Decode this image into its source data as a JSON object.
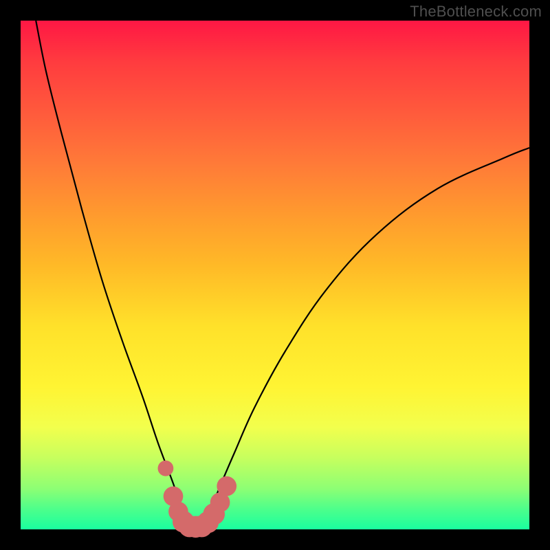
{
  "watermark": "TheBottleneck.com",
  "colors": {
    "background": "#000000",
    "curve_stroke": "#000000",
    "marker_fill": "#d46a6a",
    "watermark_text": "#4f4f4f"
  },
  "chart_data": {
    "type": "line",
    "title": "",
    "xlabel": "",
    "ylabel": "",
    "xlim": [
      0,
      100
    ],
    "ylim": [
      0,
      100
    ],
    "legend": false,
    "grid": false,
    "background_gradient": {
      "direction": "vertical",
      "stops": [
        {
          "pos": 0.0,
          "color": "#ff1744"
        },
        {
          "pos": 0.5,
          "color": "#ffb927"
        },
        {
          "pos": 0.72,
          "color": "#fff433"
        },
        {
          "pos": 1.0,
          "color": "#1aff9f"
        }
      ]
    },
    "series": [
      {
        "name": "bottleneck-curve",
        "x": [
          3,
          5,
          8,
          12,
          16,
          20,
          24,
          27,
          30,
          32,
          33.5,
          35,
          37,
          39,
          42,
          46,
          52,
          60,
          70,
          82,
          95,
          100
        ],
        "y": [
          100,
          90,
          78,
          63,
          49,
          37,
          26,
          17,
          9,
          3,
          0.5,
          0.5,
          3,
          8,
          15,
          24,
          35,
          47,
          58,
          67,
          73,
          75
        ]
      }
    ],
    "markers": [
      {
        "x": 28.5,
        "y": 12,
        "r": 1.0
      },
      {
        "x": 30.0,
        "y": 6.5,
        "r": 1.4
      },
      {
        "x": 31.0,
        "y": 3.5,
        "r": 1.4
      },
      {
        "x": 32.0,
        "y": 1.5,
        "r": 1.6
      },
      {
        "x": 33.2,
        "y": 0.6,
        "r": 1.6
      },
      {
        "x": 34.4,
        "y": 0.5,
        "r": 1.6
      },
      {
        "x": 35.6,
        "y": 0.6,
        "r": 1.6
      },
      {
        "x": 36.8,
        "y": 1.4,
        "r": 1.6
      },
      {
        "x": 38.0,
        "y": 3.0,
        "r": 1.6
      },
      {
        "x": 39.2,
        "y": 5.3,
        "r": 1.4
      },
      {
        "x": 40.5,
        "y": 8.5,
        "r": 1.4
      }
    ]
  }
}
